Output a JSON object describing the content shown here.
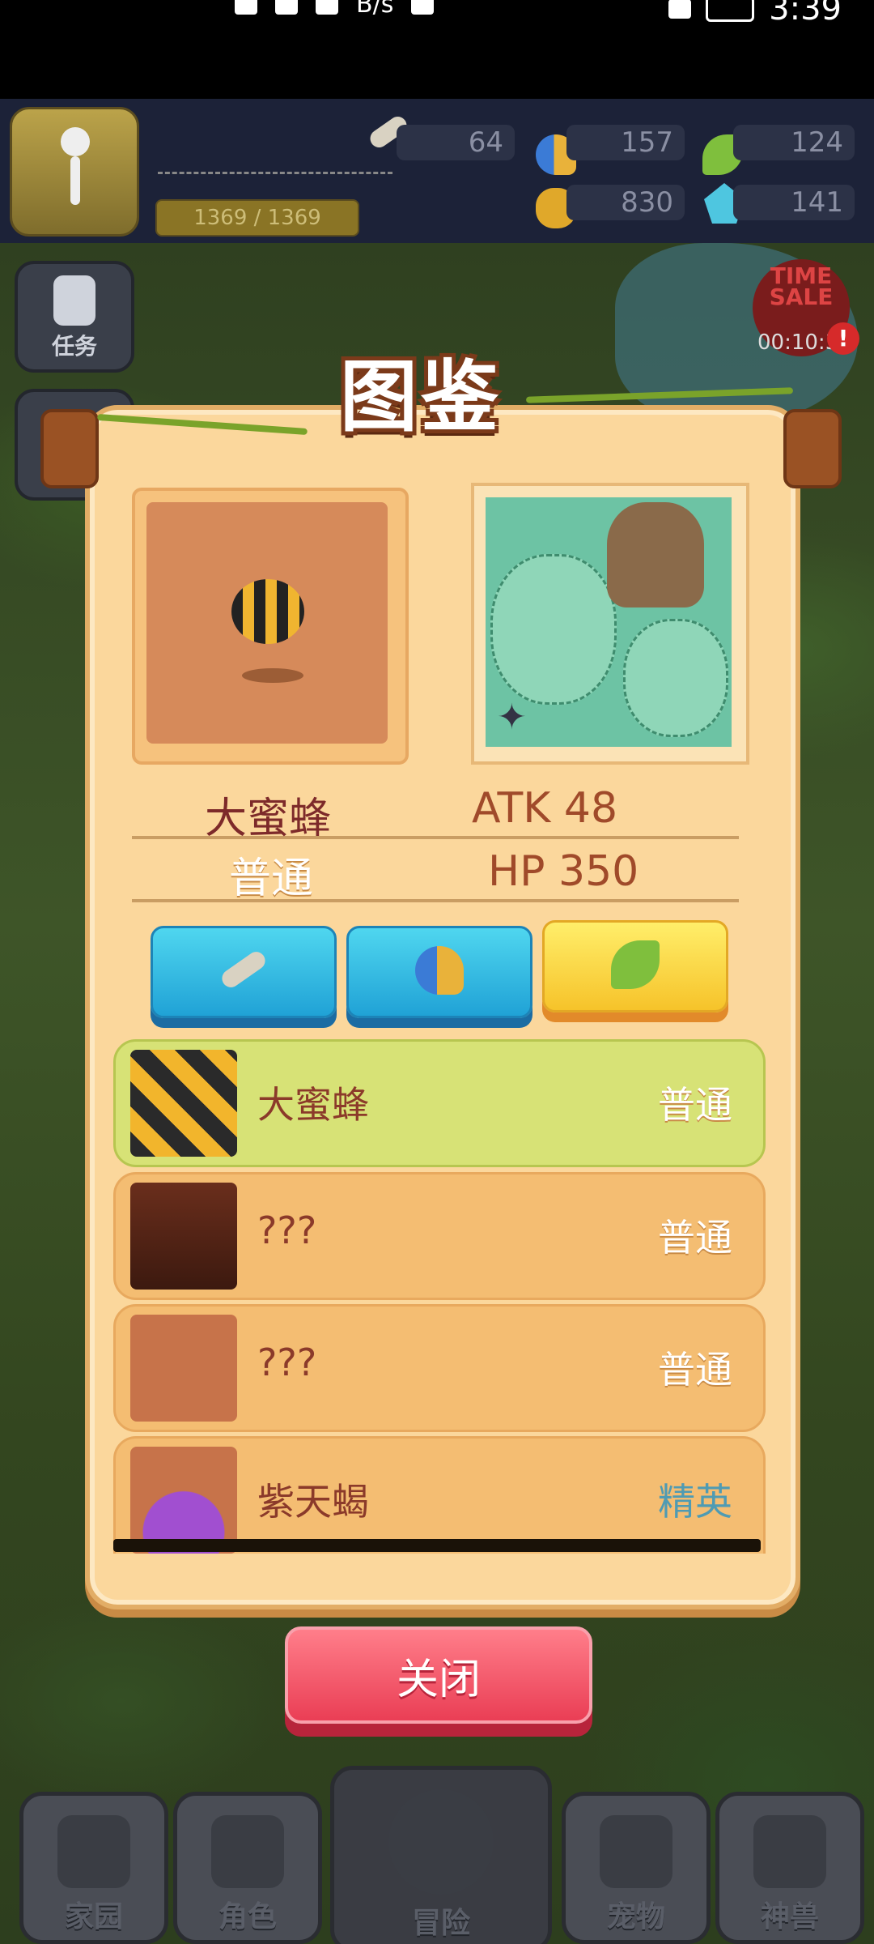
{
  "status_bar": {
    "left_text": "B/s",
    "time": "3:39"
  },
  "hud": {
    "xp_text": "1369 / 1369",
    "resources": [
      {
        "icon": "bone-icon",
        "value": "64"
      },
      {
        "icon": "horn-icon",
        "value": "157"
      },
      {
        "icon": "leaf-icon",
        "value": "124"
      },
      {
        "icon": "nut-icon",
        "value": "830"
      },
      {
        "icon": "gem-icon",
        "value": "141"
      }
    ]
  },
  "side": {
    "task_label": "任务",
    "time_sale": "TIME SALE",
    "timer": "00:10:3",
    "alert": "!"
  },
  "panel": {
    "title": "图鉴",
    "monster": {
      "name": "大蜜蜂",
      "rarity": "普通",
      "atk": "ATK 48",
      "hp": "HP 350"
    },
    "tabs": [
      {
        "icon": "bone-icon",
        "active": false
      },
      {
        "icon": "horn-icon",
        "active": false
      },
      {
        "icon": "leaf-icon",
        "active": true
      }
    ],
    "list": [
      {
        "name": "大蜜蜂",
        "rarity": "普通",
        "active": true
      },
      {
        "name": "???",
        "rarity": "普通",
        "active": false
      },
      {
        "name": "???",
        "rarity": "普通",
        "active": false
      },
      {
        "name": "紫天蝎",
        "rarity": "精英",
        "active": false
      }
    ]
  },
  "close_label": "关闭",
  "nav": [
    {
      "label": "家园"
    },
    {
      "label": "角色"
    },
    {
      "label": "冒险"
    },
    {
      "label": "宠物"
    },
    {
      "label": "神兽"
    }
  ]
}
